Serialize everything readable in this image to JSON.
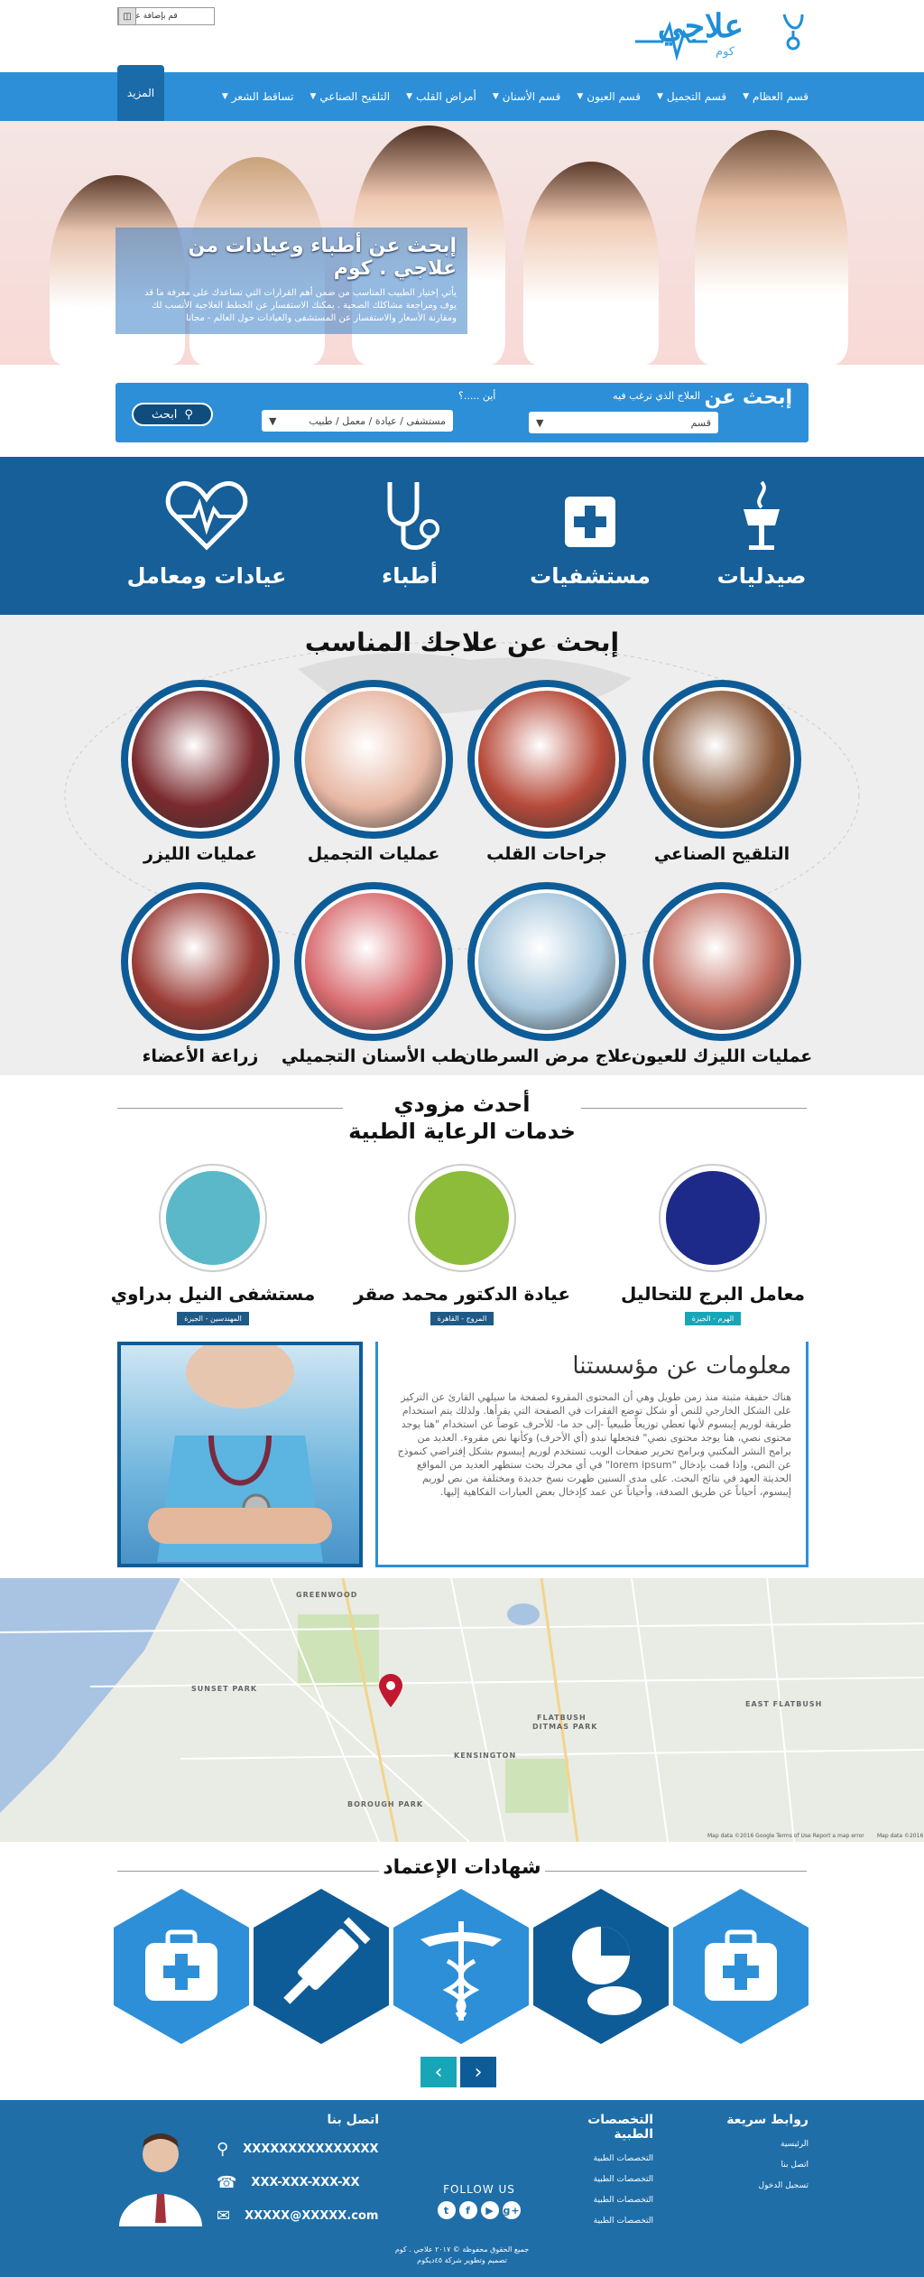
{
  "header": {
    "logo_text": "علاجي",
    "logo_sub": "كوم",
    "register_label": "قم بإضافة عيادتك"
  },
  "nav": {
    "items": [
      "قسم العظام",
      "قسم التجميل",
      "قسم العيون",
      "قسم الأسنان",
      "أمراض القلب",
      "التلقيح الصناعي",
      "تساقط الشعر"
    ],
    "more_label": "المزيد"
  },
  "hero": {
    "title": "إبحث عن أطباء وعيادات من علاجي . كوم",
    "text": "يأتي إختيار الطبيب المناسب من ضمن أهم القرارات التي تساعدك على معرفة ما قد يوف ومراجعة مشاكلك الصحية . يمكنك الاستفسار عن الخطط العلاجية الأنسب لك ومقارنة الأسعار والاستفسار عن المستشفى والعيادات حول العالم - مجانا"
  },
  "search": {
    "title": "إبحث عن",
    "label_treatment": "العلاج الذي ترغب فيه",
    "label_where": "أين .....؟",
    "select_dept": "قسم",
    "select_place": "مستشفى / عيادة / معمل / طبيب",
    "button_label": "ابحث"
  },
  "categories": [
    {
      "name": "صيدليات"
    },
    {
      "name": "مستشفيات"
    },
    {
      "name": "أطباء"
    },
    {
      "name": "عيادات ومعامل"
    }
  ],
  "find": {
    "title": "إبحث عن علاجك المناسب",
    "items": [
      {
        "label": "التلقيح الصناعي",
        "color": "#8b5a3c"
      },
      {
        "label": "جراحات القلب",
        "color": "#b74a3a"
      },
      {
        "label": "عمليات التجميل",
        "color": "#e7b7a3"
      },
      {
        "label": "عمليات الليزر",
        "color": "#7b2a2e"
      },
      {
        "label": "عمليات الليزك للعيون",
        "color": "#c46f63"
      },
      {
        "label": "علاج مرض السرطان",
        "color": "#a7c7dc"
      },
      {
        "label": "طب الأسنان التجميلي",
        "color": "#d86b6f"
      },
      {
        "label": "زراعة الأعضاء",
        "color": "#9a3b35"
      }
    ]
  },
  "providers": {
    "title_line1": "أحدث مزودي",
    "title_line2": "خدمات الرعاية الطبية",
    "items": [
      {
        "name": "معامل البرج للتحاليل",
        "tag": "الهرم - الجيزة",
        "color": "#1e2a8a",
        "tag_color": "#17a6b8"
      },
      {
        "name": "عيادة الدكتور محمد صقر",
        "tag": "المروج - القاهرة",
        "color": "#8cbc3a",
        "tag_color": "#1f5a86"
      },
      {
        "name": "مستشفى النيل بدراوي",
        "tag": "المهندسين - الجيزة",
        "color": "#5ab8c8",
        "tag_color": "#1f5a86"
      }
    ]
  },
  "about": {
    "title": "معلومات عن مؤسستنا",
    "text": "هناك حقيقة مثبتة منذ زمن طويل وهي أن المحتوى المقروء لصفحة ما سيلهي القارئ عن التركيز على الشكل الخارجي للنص أو شكل توضع الفقرات في الصفحة التي يقرأها. ولذلك يتم استخدام طريقة لوريم إيبسوم لأنها تعطي توزيعاً طبيعياً -إلى حد ما- للأحرف عوضاً عن استخدام \"هنا يوجد محتوى نصي، هنا يوجد محتوى نصي\" فتجعلها تبدو (أي الأحرف) وكأنها نص مقروء. العديد من برامح النشر المكتبي وبرامح تحرير صفحات الويب تستخدم لوريم إيبسوم بشكل إفتراضي كنموذج عن النص، وإذا قمت بإدخال \"lorem ipsum\" في أي محرك بحث ستظهر العديد من المواقع الحديثة العهد في نتائج البحث. على مدى السنين ظهرت نسخ جديدة ومختلفة من نص لوريم إيبسوم، أحياناً عن طريق الصدفة، وأحياناً عن عمد كإدخال بعض العبارات الفكاهية إليها."
  },
  "map": {
    "labels": [
      "GREENWOOD",
      "SUNSET PARK",
      "DITMAS PARK",
      "FLATBUSH",
      "EAST FLATBUSH",
      "KENSINGTON",
      "BOROUGH PARK"
    ],
    "footer_text": "Map data ©2016 Google   Terms of Use   Report a map error",
    "footer_right": "Map data ©2016"
  },
  "certs": {
    "title": "شهادات الإعتماد",
    "prev": "‹",
    "next": "›"
  },
  "footer": {
    "quick_title": "روابط سريعة",
    "quick_links": [
      "الرئيسية",
      "اتصل بنا",
      "تسجيل الدخول"
    ],
    "spec_title": "التخصصات الطبية",
    "spec_links": [
      "التخصصات الطبية",
      "التخصصات الطبية",
      "التخصصات الطبية",
      "التخصصات الطبية"
    ],
    "contact_title": "اتصل بنا",
    "phone1": "XXXXXXXXXXXXXXX",
    "phone2": "XXX-XXX-XXX-XX",
    "email": "XXXXX@XXXXX.com",
    "follow": "FOLLOW US",
    "copy1": "جميع الحقوق محفوظة © ٢٠١٧ علاجي . كوم",
    "copy2": "تصميم وتطوير شركة ٤٥ديكوم"
  }
}
